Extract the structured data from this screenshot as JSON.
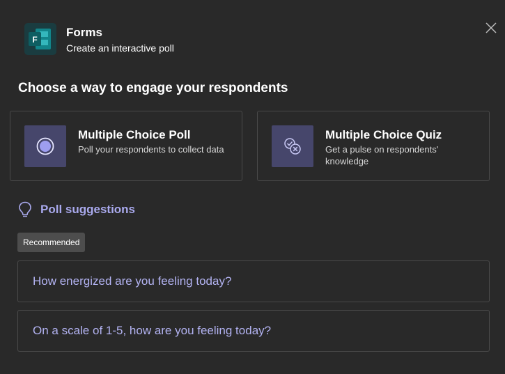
{
  "header": {
    "app_name": "Forms",
    "subtitle": "Create an interactive poll",
    "logo_icon": "forms-logo-icon",
    "close_icon": "close-icon"
  },
  "section_heading": "Choose a way to engage your respondents",
  "options": [
    {
      "title": "Multiple Choice Poll",
      "description": "Poll your respondents to collect data",
      "icon": "radio-button-icon"
    },
    {
      "title": "Multiple Choice Quiz",
      "description": "Get a pulse on respondents' knowledge",
      "icon": "quiz-check-icon"
    }
  ],
  "suggestions": {
    "label": "Poll suggestions",
    "icon": "lightbulb-icon",
    "badge": "Recommended",
    "items": [
      "How energized are you feeling today?",
      "On a scale of 1-5, how are you feeling today?"
    ]
  },
  "colors": {
    "background": "#292929",
    "accent": "#a9a9ed",
    "icon_box": "#46466b",
    "logo_teal": "#0f7a7f"
  }
}
